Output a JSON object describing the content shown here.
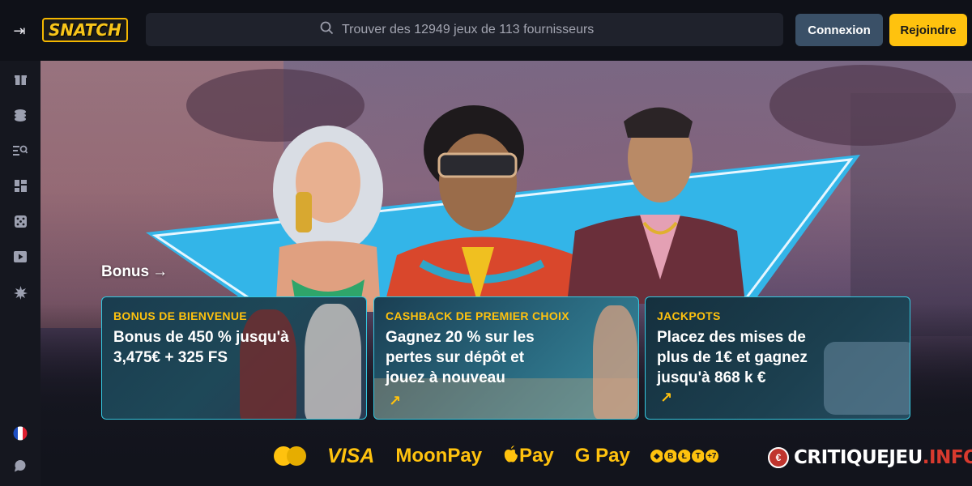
{
  "header": {
    "logo_text": "SNATCH",
    "search_placeholder": "Trouver des 12949 jeux de 113 fournisseurs",
    "login_label": "Connexion",
    "join_label": "Rejoindre"
  },
  "sidebar": {
    "items": [
      {
        "icon": "gift-icon"
      },
      {
        "icon": "coins-icon"
      },
      {
        "icon": "search-list-icon"
      },
      {
        "icon": "dashboard-icon"
      },
      {
        "icon": "dice-icon"
      },
      {
        "icon": "play-icon"
      },
      {
        "icon": "burst-icon"
      },
      {
        "icon": "france-flag-icon"
      },
      {
        "icon": "chat-icon"
      }
    ]
  },
  "hero": {
    "section_link": "Bonus",
    "cards": [
      {
        "eyebrow": "BONUS DE BIENVENUE",
        "headline": "Bonus de 450 % jusqu'à 3,475€ + 325 FS"
      },
      {
        "eyebrow": "CASHBACK DE PREMIER CHOIX",
        "headline": "Gagnez 20 % sur les pertes sur dépôt et jouez à nouveau"
      },
      {
        "eyebrow": "JACKPOTS",
        "headline": "Placez des mises de plus de 1€ et gagnez jusqu'à 868 k €"
      }
    ]
  },
  "payments": {
    "visa": "VISA",
    "moonpay": "MoonPay",
    "applepay": "Pay",
    "googlepay": "G Pay",
    "crypto_more": "+7"
  },
  "watermark": {
    "main": "CRITIQUEJEU",
    "suffix": ".INFO"
  },
  "colors": {
    "accent": "#ffc20e",
    "login_bg": "#3a5067",
    "card_border": "#35c8e0"
  }
}
